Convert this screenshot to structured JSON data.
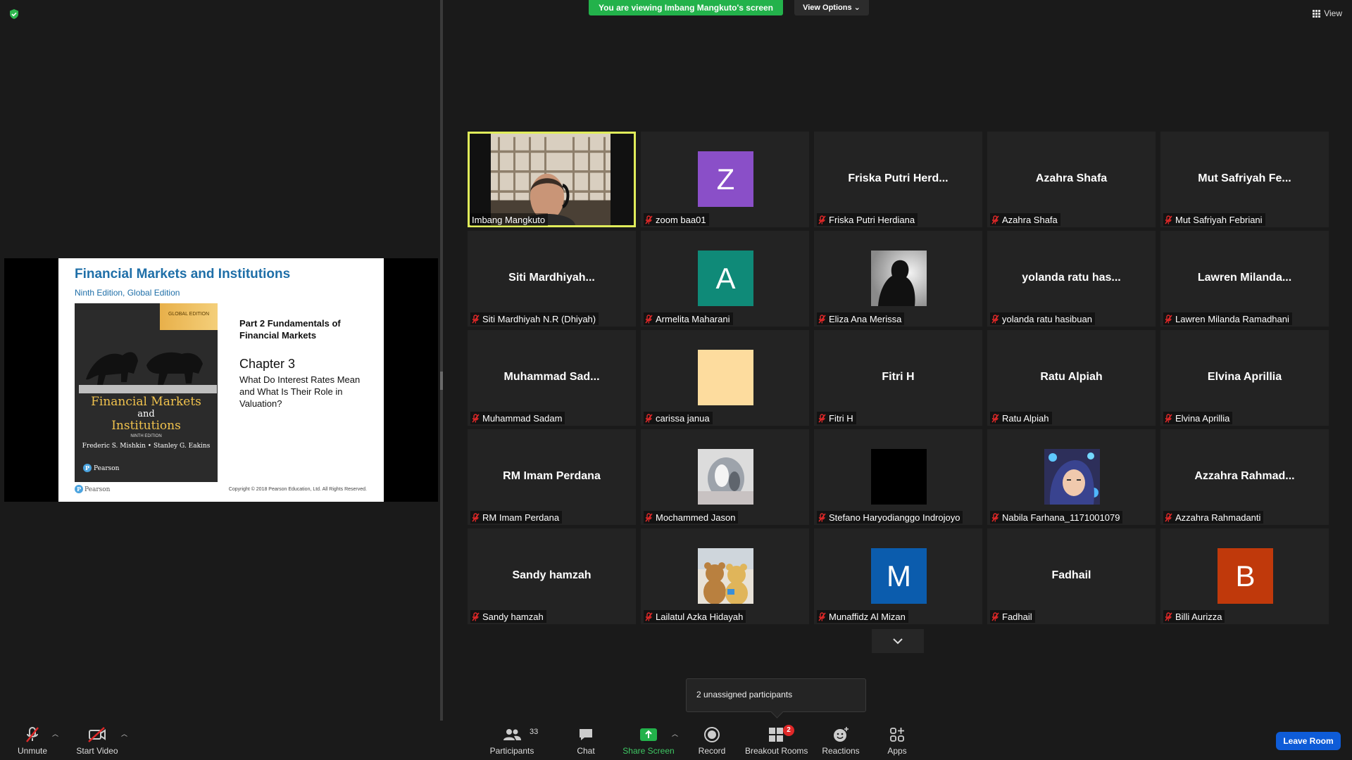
{
  "banner": {
    "viewing_text": "You are viewing Imbang Mangkuto's screen",
    "view_options": "View Options",
    "view": "View"
  },
  "slide": {
    "title": "Financial Markets and Institutions",
    "edition": "Ninth Edition, Global Edition",
    "book_badge": "GLOBAL EDITION",
    "book_title_1": "Financial Markets",
    "book_title_2": "and",
    "book_title_3": "Institutions",
    "book_edition": "NINTH EDITION",
    "book_authors": "Frederic S. Mishkin • Stanley G. Eakins",
    "book_publisher": "Pearson",
    "part": "Part 2 Fundamentals of Financial Markets",
    "chapter": "Chapter 3",
    "chapter_subtitle": "What Do Interest Rates Mean and What Is Their Role in Valuation?",
    "footer_logo": "Pearson",
    "copyright": "Copyright © 2018 Pearson Education, Ltd. All Rights Reserved."
  },
  "participants": [
    {
      "label": "Imbang Mangkuto",
      "type": "video",
      "active": true,
      "muted": false
    },
    {
      "label": "zoom baa01",
      "type": "avatar",
      "letter": "Z",
      "color": "#8a4fc8",
      "muted": true
    },
    {
      "label": "Friska Putri Herdiana",
      "center": "Friska Putri Herd...",
      "type": "name",
      "muted": true
    },
    {
      "label": "Azahra Shafa",
      "center": "Azahra Shafa",
      "type": "name",
      "muted": true
    },
    {
      "label": "Mut Safriyah Febriani",
      "center": "Mut Safriyah Fe...",
      "type": "name",
      "muted": true
    },
    {
      "label": "Siti Mardhiyah N.R (Dhiyah)",
      "center": "Siti Mardhiyah...",
      "type": "name",
      "muted": true
    },
    {
      "label": "Armelita Maharani",
      "type": "avatar",
      "letter": "A",
      "color": "#0f8a78",
      "muted": true
    },
    {
      "label": "Eliza Ana Merissa",
      "type": "photo",
      "photo": "silhouette",
      "muted": true
    },
    {
      "label": "yolanda ratu hasibuan",
      "center": "yolanda ratu has...",
      "type": "name",
      "muted": true
    },
    {
      "label": "Lawren Milanda Ramadhani",
      "center": "Lawren Milanda...",
      "type": "name",
      "muted": true
    },
    {
      "label": "Muhammad Sadam",
      "center": "Muhammad Sad...",
      "type": "name",
      "muted": true
    },
    {
      "label": "carissa janua",
      "type": "avatar",
      "letter": "",
      "color": "#fddc9e",
      "muted": true
    },
    {
      "label": "Fitri H",
      "center": "Fitri H",
      "type": "name",
      "muted": true
    },
    {
      "label": "Ratu Alpiah",
      "center": "Ratu Alpiah",
      "type": "name",
      "muted": true
    },
    {
      "label": "Elvina Aprillia",
      "center": "Elvina Aprillia",
      "type": "name",
      "muted": true
    },
    {
      "label": "RM Imam Perdana",
      "center": "RM Imam Perdana",
      "type": "name",
      "muted": true
    },
    {
      "label": "Mochammed Jason",
      "type": "photo",
      "photo": "glass",
      "muted": true
    },
    {
      "label": "Stefano Haryodianggo Indrojoyo",
      "type": "photo",
      "photo": "black",
      "muted": true
    },
    {
      "label": "Nabila Farhana_1171001079",
      "type": "photo",
      "photo": "hijab",
      "muted": true
    },
    {
      "label": "Azzahra Rahmadanti",
      "center": "Azzahra Rahmad...",
      "type": "name",
      "muted": true
    },
    {
      "label": "Sandy hamzah",
      "center": "Sandy hamzah",
      "type": "name",
      "muted": true
    },
    {
      "label": "Lailatul Azka Hidayah",
      "type": "photo",
      "photo": "bears",
      "muted": true
    },
    {
      "label": "Munaffidz Al Mizan",
      "type": "avatar",
      "letter": "M",
      "color": "#0b5cad",
      "muted": true
    },
    {
      "label": "Fadhail",
      "center": "Fadhail",
      "type": "name",
      "muted": true
    },
    {
      "label": "Billi Aurizza",
      "type": "avatar",
      "letter": "B",
      "color": "#c0390b",
      "muted": true
    }
  ],
  "tooltip": {
    "text": "2 unassigned participants"
  },
  "toolbar": {
    "unmute": "Unmute",
    "start_video": "Start Video",
    "participants": "Participants",
    "participants_count": "33",
    "chat": "Chat",
    "share_screen": "Share Screen",
    "record": "Record",
    "breakout_rooms": "Breakout Rooms",
    "breakout_badge": "2",
    "reactions": "Reactions",
    "apps": "Apps",
    "leave_room": "Leave Room"
  },
  "colors": {
    "active_speaker": "#e0ec5a",
    "banner_green": "#23b24b",
    "leave_blue": "#0e5cd8",
    "muted_red": "#e02828"
  }
}
